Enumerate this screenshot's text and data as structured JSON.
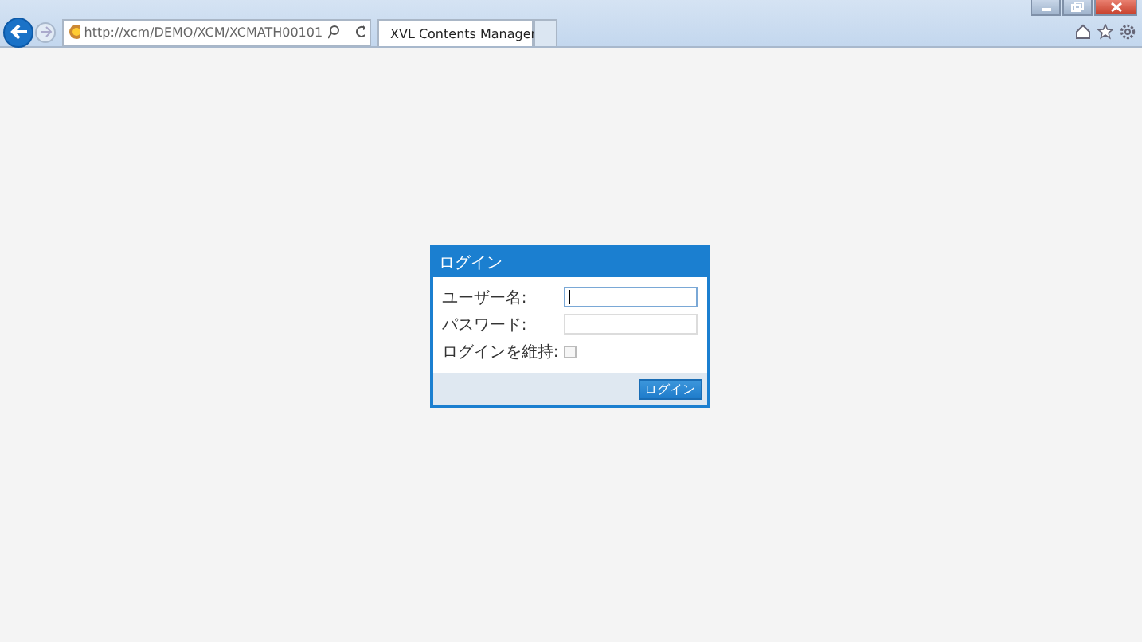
{
  "browser": {
    "address": "http://xcm/DEMO/XCM/XCMATH00101",
    "tabs": [
      {
        "title": "XVL Contents Manager",
        "selected": true
      }
    ]
  },
  "dialog": {
    "title": "ログイン",
    "fields": [
      {
        "kind": "text",
        "label": "ユーザー名:",
        "focused": true
      },
      {
        "kind": "password",
        "label": "パスワード:",
        "focused": false
      },
      {
        "kind": "checkbox",
        "label": "ログインを維持:",
        "checked": false
      }
    ],
    "button": "ログイン"
  }
}
